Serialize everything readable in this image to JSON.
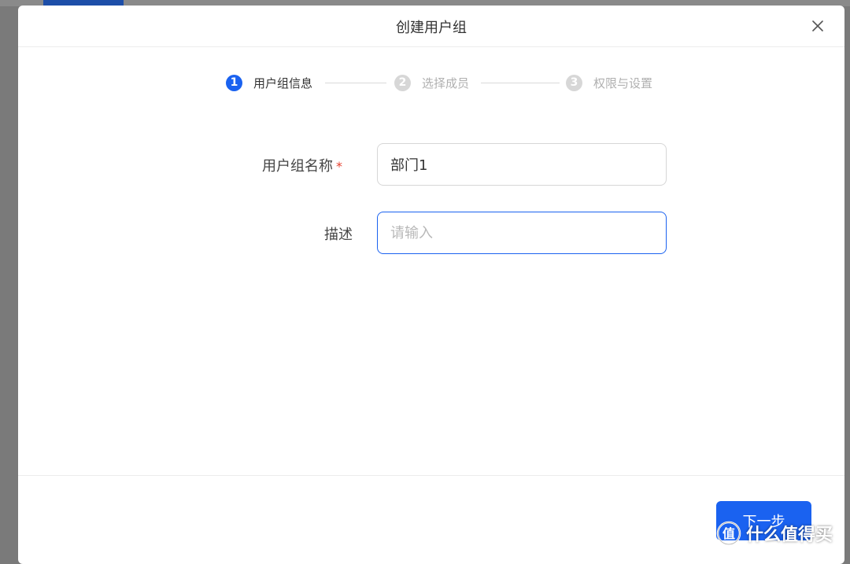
{
  "modal": {
    "title": "创建用户组",
    "close_icon": "close-icon"
  },
  "steps": [
    {
      "number": "1",
      "label": "用户组信息",
      "active": true
    },
    {
      "number": "2",
      "label": "选择成员",
      "active": false
    },
    {
      "number": "3",
      "label": "权限与设置",
      "active": false
    }
  ],
  "form": {
    "name_label": "用户组名称",
    "required_mark": "*",
    "name_value": "部门1",
    "desc_label": "描述",
    "desc_placeholder": "请输入"
  },
  "footer": {
    "next_label": "下一步"
  },
  "watermark": {
    "text": "值 什么值得买",
    "icon": "smzdm-logo-icon"
  },
  "colors": {
    "primary": "#1a62f0",
    "required": "#e6402e",
    "step_inactive": "#d7d7d7",
    "overlay": "#7a7a7a"
  }
}
